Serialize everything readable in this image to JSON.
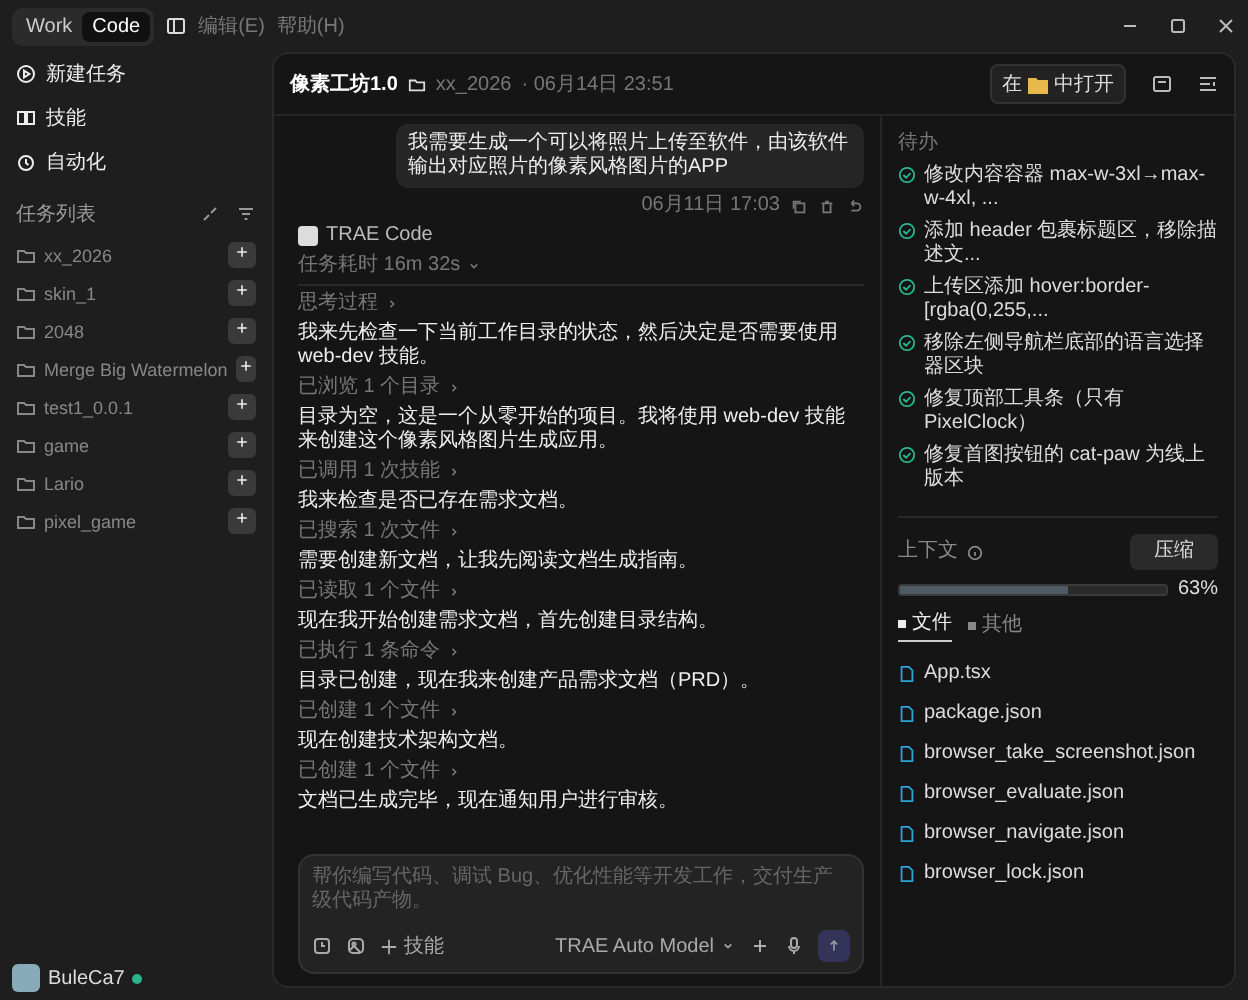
{
  "titlebar": {
    "modes": [
      {
        "label": "Work",
        "selected": false
      },
      {
        "label": "Code",
        "selected": true
      }
    ],
    "menus": [
      "编辑(E)",
      "帮助(H)"
    ]
  },
  "sidebar": {
    "actions": [
      {
        "kind": "new",
        "label": "新建任务"
      },
      {
        "kind": "skills",
        "label": "技能"
      },
      {
        "kind": "auto",
        "label": "自动化"
      }
    ],
    "task_list_title": "任务列表",
    "projects": [
      "xx_2026",
      "skin_1",
      "2048",
      "Merge Big Watermelon",
      "test1_0.0.1",
      "game",
      "Lario",
      "pixel_game"
    ],
    "user": {
      "name": "BuleCa7",
      "online": true
    }
  },
  "header": {
    "title": "像素工坊1.0",
    "project": "xx_2026",
    "datetime": "· 06月14日 23:51",
    "open_prefix": "在",
    "open_suffix": "中打开"
  },
  "chat": {
    "user_message": "我需要生成一个可以将照片上传至软件，由该软件输出对应照片的像素风格图片的APP",
    "timestamp": "06月11日 17:03",
    "agent": "TRAE Code",
    "duration": "任务耗时 16m 32s",
    "thinking": "思考过程",
    "steps": [
      {
        "kind": "text",
        "text": "我来先检查一下当前工作目录的状态，然后决定是否需要使用 web-dev 技能。"
      },
      {
        "kind": "tool",
        "text": "已浏览 1 个目录"
      },
      {
        "kind": "text",
        "text": "目录为空，这是一个从零开始的项目。我将使用 web-dev 技能来创建这个像素风格图片生成应用。"
      },
      {
        "kind": "tool",
        "text": "已调用 1 次技能"
      },
      {
        "kind": "text",
        "text": "我来检查是否已存在需求文档。"
      },
      {
        "kind": "tool",
        "text": "已搜索 1 次文件"
      },
      {
        "kind": "text",
        "text": "需要创建新文档，让我先阅读文档生成指南。"
      },
      {
        "kind": "tool",
        "text": "已读取 1 个文件"
      },
      {
        "kind": "text",
        "text": "现在我开始创建需求文档，首先创建目录结构。"
      },
      {
        "kind": "tool",
        "text": "已执行 1 条命令"
      },
      {
        "kind": "text",
        "text": "目录已创建，现在我来创建产品需求文档（PRD）。"
      },
      {
        "kind": "tool",
        "text": "已创建 1 个文件"
      },
      {
        "kind": "text",
        "text": "现在创建技术架构文档。"
      },
      {
        "kind": "tool",
        "text": "已创建 1 个文件"
      },
      {
        "kind": "text",
        "text": "文档已生成完毕，现在通知用户进行审核。"
      }
    ]
  },
  "composer": {
    "placeholder": "帮你编写代码、调试 Bug、优化性能等开发工作，交付生产级代码产物。",
    "skills": "技能",
    "model": "TRAE Auto Model"
  },
  "todo": {
    "title": "待办",
    "items": [
      {
        "text": "修改内容容器 max-w-3xl→max-w-4xl, ...",
        "done": true
      },
      {
        "text": "添加 header 包裹标题区，移除描述文...",
        "done": true
      },
      {
        "text": "上传区添加 hover:border-[rgba(0,255,...",
        "done": true
      },
      {
        "text": "移除左侧导航栏底部的语言选择器区块",
        "done": true
      },
      {
        "text": "修复顶部工具条（只有 PixelClock）",
        "done": true
      },
      {
        "text": "修复首图按钮的 cat-paw 为线上版本",
        "done": true
      }
    ]
  },
  "context": {
    "title": "上下文",
    "compress": "压缩",
    "level": 0.63,
    "reading": "63%",
    "tabs": [
      {
        "label": "文件",
        "selected": true
      },
      {
        "label": "其他",
        "selected": false
      }
    ],
    "files": [
      "App.tsx",
      "package.json",
      "browser_take_screenshot.json",
      "browser_evaluate.json",
      "browser_navigate.json",
      "browser_lock.json"
    ]
  }
}
